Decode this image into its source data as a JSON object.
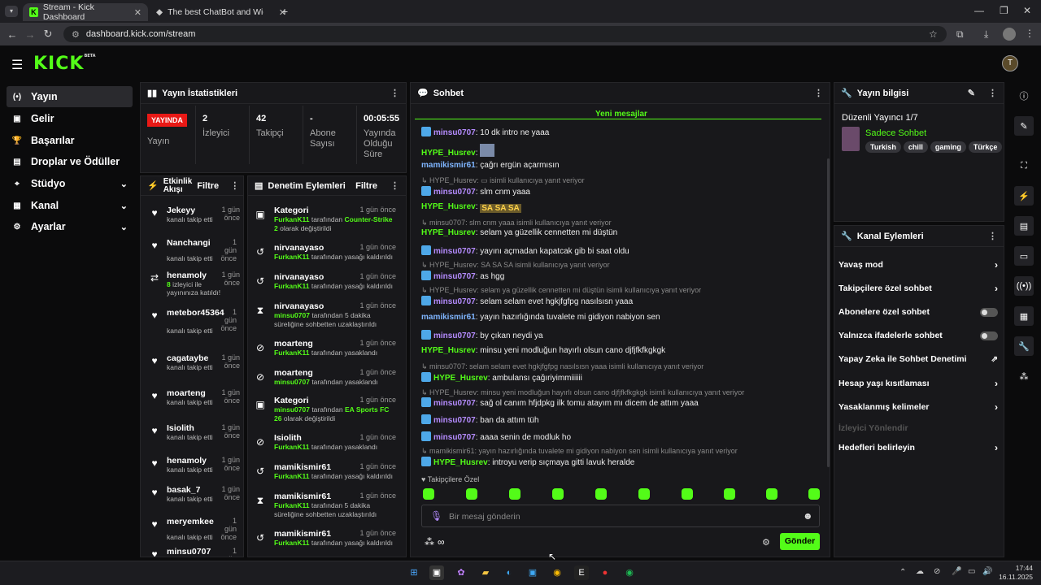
{
  "browser": {
    "tabs": [
      {
        "title": "Stream - Kick Dashboard"
      },
      {
        "title": "The best ChatBot and Widgets"
      }
    ],
    "url": "dashboard.kick.com/stream"
  },
  "app": {
    "logo": "KICK",
    "logo_sup": "BETA",
    "avatar": "T"
  },
  "sidebar": [
    {
      "label": "Yayın",
      "icon": "(•)"
    },
    {
      "label": "Gelir",
      "icon": "▣"
    },
    {
      "label": "Başarılar",
      "icon": "🏆"
    },
    {
      "label": "Droplar ve Ödüller",
      "icon": "▤"
    },
    {
      "label": "Stüdyo",
      "icon": "⌖"
    },
    {
      "label": "Kanal",
      "icon": "▦"
    },
    {
      "label": "Ayarlar",
      "icon": "⚙"
    }
  ],
  "stats": {
    "title": "Yayın İstatistikleri",
    "live_badge": "YAYINDA",
    "live_label": "Yayın",
    "viewers": {
      "value": "2",
      "label": "İzleyici"
    },
    "followers": {
      "value": "42",
      "label": "Takipçi"
    },
    "subs": {
      "value": "-",
      "label": "Abone Sayısı"
    },
    "uptime": {
      "value": "00:05:55",
      "label": "Yayında Olduğu Süre"
    }
  },
  "activity": {
    "title": "Etkinlik Akışı",
    "filter": "Filtre",
    "items": [
      {
        "name": "Jekeyy",
        "time": "1 gün önce",
        "sub": "kanalı takip etti"
      },
      {
        "name": "Nanchangi",
        "time": "1 gün önce",
        "sub": "kanalı takip etti"
      },
      {
        "name": "henamoly",
        "time": "1 gün önce",
        "sub_num": "8",
        "sub": " izleyici ile",
        "sub2": "yayınınıza katıldı!"
      },
      {
        "name": "metebor45364",
        "time": "1 gün önce",
        "sub": "kanalı takip etti"
      },
      {
        "name": "cagataybe",
        "time": "1 gün önce",
        "sub": "kanalı takip etti"
      },
      {
        "name": "moarteng",
        "time": "1 gün önce",
        "sub": "kanalı takip etti"
      },
      {
        "name": "Isiolith",
        "time": "1 gün önce",
        "sub": "kanalı takip etti"
      },
      {
        "name": "henamoly",
        "time": "1 gün önce",
        "sub": "kanalı takip etti"
      },
      {
        "name": "basak_7",
        "time": "1 gün önce",
        "sub": "kanalı takip etti"
      },
      {
        "name": "meryemkee",
        "time": "1 gün önce",
        "sub": "kanalı takip etti"
      },
      {
        "name": "minsu0707",
        "time": "1 gün önce",
        "sub": ""
      }
    ]
  },
  "moderation": {
    "title": "Denetim Eylemleri",
    "filter": "Filtre",
    "items": [
      {
        "name": "Kategori",
        "time": "1 gün önce",
        "by": "FurkanK11",
        "mid": " tarafından ",
        "target": "Counter-Strike 2",
        "end": " olarak değiştirildi"
      },
      {
        "name": "nirvanayaso",
        "time": "1 gün önce",
        "by": "FurkanK11",
        "mid": " tarafından yasağı kaldırıldı",
        "target": "",
        "end": ""
      },
      {
        "name": "nirvanayaso",
        "time": "1 gün önce",
        "by": "FurkanK11",
        "mid": " tarafından yasağı kaldırıldı",
        "target": "",
        "end": ""
      },
      {
        "name": "nirvanayaso",
        "time": "1 gün önce",
        "by": "minsu0707",
        "mid": " tarafından 5 dakika süreliğine sohbetten uzaklaştırıldı",
        "target": "",
        "end": ""
      },
      {
        "name": "moarteng",
        "time": "1 gün önce",
        "by": "FurkanK11",
        "mid": " tarafından yasaklandı",
        "target": "",
        "end": ""
      },
      {
        "name": "moarteng",
        "time": "1 gün önce",
        "by": "minsu0707",
        "mid": " tarafından yasaklandı",
        "target": "",
        "end": ""
      },
      {
        "name": "Kategori",
        "time": "1 gün önce",
        "by": "minsu0707",
        "mid": " tarafından ",
        "target": "EA Sports FC 26",
        "end": " olarak değiştirildi"
      },
      {
        "name": "Isiolith",
        "time": "1 gün önce",
        "by": "FurkanK11",
        "mid": " tarafından yasaklandı",
        "target": "",
        "end": ""
      },
      {
        "name": "mamikismir61",
        "time": "1 gün önce",
        "by": "FurkanK11",
        "mid": " tarafından yasağı kaldırıldı",
        "target": "",
        "end": ""
      },
      {
        "name": "mamikismir61",
        "time": "1 gün önce",
        "by": "FurkanK11",
        "mid": " tarafından 5 dakika süreliğine sohbetten uzaklaştırıldı",
        "target": "",
        "end": ""
      },
      {
        "name": "mamikismir61",
        "time": "1 gün önce",
        "by": "FurkanK11",
        "mid": " tarafından yasağı kaldırıldı",
        "target": "",
        "end": ""
      }
    ]
  },
  "chat": {
    "title": "Sohbet",
    "new_messages": "Yeni mesajlar",
    "followers_only": "Takipçilere Özel",
    "placeholder": "Bir mesaj gönderin",
    "send": "Gönder",
    "lines": [
      {
        "t": "m",
        "user": "minsu0707",
        "c": "p",
        "badge": true,
        "text": ": 10 dk intro ne yaaa"
      },
      {
        "t": "m",
        "user": "HYPE_Husrev",
        "c": "g",
        "text": ": ",
        "emote": "IMG"
      },
      {
        "t": "m",
        "user": "mamikismir61",
        "c": "b",
        "text": ": çağrı ergün açarmısın"
      },
      {
        "t": "r",
        "text": "↳ HYPE_Husrev:  ▭  isimli kullanıcıya yanıt veriyor"
      },
      {
        "t": "m",
        "user": "minsu0707",
        "c": "p",
        "badge": true,
        "text": ": slm cnm yaaa"
      },
      {
        "t": "m",
        "user": "HYPE_Husrev",
        "c": "g",
        "text": ": ",
        "emote": "SA SA SA"
      },
      {
        "t": "r",
        "text": "↳ minsu0707: slm cnm yaaa isimli kullanıcıya yanıt veriyor"
      },
      {
        "t": "m",
        "user": "HYPE_Husrev",
        "c": "g",
        "text": ": selam ya güzellik cennetten mi düştün"
      },
      {
        "t": "m",
        "user": "minsu0707",
        "c": "p",
        "badge": true,
        "text": ": yayını açmadan kapatcak gib bi saat oldu"
      },
      {
        "t": "r",
        "text": "↳ HYPE_Husrev:  SA SA SA  isimli kullanıcıya yanıt veriyor"
      },
      {
        "t": "m",
        "user": "minsu0707",
        "c": "p",
        "badge": true,
        "text": ": as hgg"
      },
      {
        "t": "r",
        "text": "↳ HYPE_Husrev: selam ya güzellik cennetten mi düştün isimli kullanıcıya yanıt veriyor"
      },
      {
        "t": "m",
        "user": "minsu0707",
        "c": "p",
        "badge": true,
        "text": ": selam selam evet hgkjfgfpg nasılsısn yaaa"
      },
      {
        "t": "m",
        "user": "mamikismir61",
        "c": "b",
        "text": ": yayın hazırlığında tuvalete mi gidiyon nabiyon sen"
      },
      {
        "t": "m",
        "user": "minsu0707",
        "c": "p",
        "badge": true,
        "text": ": by çıkan neydi ya"
      },
      {
        "t": "m",
        "user": "HYPE_Husrev",
        "c": "g",
        "text": ": minsu yeni modluğun hayırlı olsun cano djfjfkfkgkgk"
      },
      {
        "t": "r",
        "text": "↳ minsu0707: selam selam evet hgkjfgfpg nasılsısn yaaa isimli kullanıcıya yanıt veriyor"
      },
      {
        "t": "m",
        "user": "HYPE_Husrev",
        "c": "g",
        "badge": true,
        "text": ": ambulansı çağıriyimmiiiiii"
      },
      {
        "t": "r",
        "text": "↳ HYPE_Husrev: minsu yeni modluğun hayırlı olsun cano djfjfkfkgkgk isimli kullanıcıya yanıt veriyor"
      },
      {
        "t": "m",
        "user": "minsu0707",
        "c": "p",
        "badge": true,
        "text": ": sağ ol canım hfjdpkg ilk tomu atayım mı dicem de attım yaaa"
      },
      {
        "t": "m",
        "user": "minsu0707",
        "c": "p",
        "badge": true,
        "text": ": ban da attım tüh"
      },
      {
        "t": "m",
        "user": "minsu0707",
        "c": "p",
        "badge": true,
        "text": ": aaaa senin de modluk ho"
      },
      {
        "t": "r",
        "text": "↳ mamikismir61: yayın hazırlığında tuvalete mi gidiyon nabiyon sen isimli kullanıcıya yanıt veriyor"
      },
      {
        "t": "m",
        "user": "HYPE_Husrev",
        "c": "g",
        "badge": true,
        "text": ": introyu verip sıçmaya gitti lavuk heralde"
      }
    ]
  },
  "info": {
    "title": "Yayın bilgisi",
    "stream_title": "Düzenli Yayıncı 1/7",
    "category": "Sadece Sohbet",
    "tags": [
      "Turkish",
      "chill",
      "gaming",
      "Türkçe"
    ]
  },
  "channel_actions": {
    "title": "Kanal Eylemleri",
    "items": [
      {
        "label": "Yavaş mod",
        "ctl": "arrow"
      },
      {
        "label": "Takipçilere özel sohbet",
        "ctl": "arrow"
      },
      {
        "label": "Abonelere özel sohbet",
        "ctl": "toggle"
      },
      {
        "label": "Yalnızca ifadelerle sohbet",
        "ctl": "toggle"
      },
      {
        "label": "Yapay Zeka ile Sohbet Denetimi",
        "ctl": "ext"
      },
      {
        "label": "Hesap yaşı kısıtlaması",
        "ctl": "arrow"
      },
      {
        "label": "Yasaklanmış kelimeler",
        "ctl": "arrow"
      },
      {
        "label": "İzleyici Yönlendir",
        "ctl": "none",
        "disabled": true
      },
      {
        "label": "Hedefleri belirleyin",
        "ctl": "arrow"
      }
    ]
  },
  "taskbar": {
    "time": "17:44",
    "date": "16.11.2025"
  }
}
